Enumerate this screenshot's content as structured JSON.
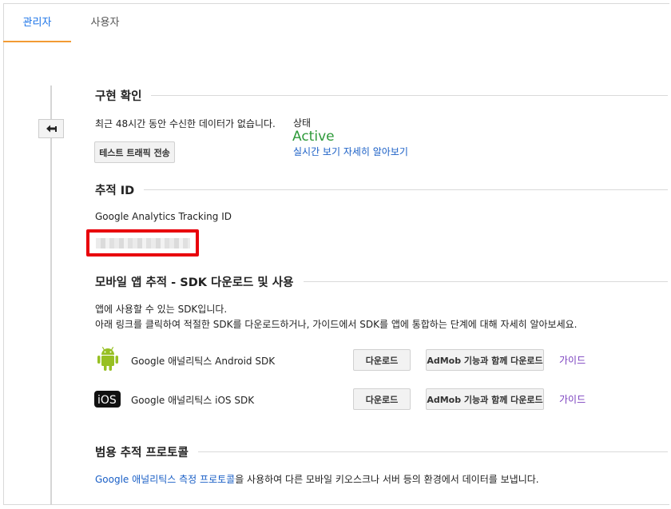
{
  "tabs": {
    "admin": "관리자",
    "user": "사용자"
  },
  "implementation": {
    "title": "구현 확인",
    "no_data_text": "최근 48시간 동안 수신한 데이터가 없습니다.",
    "test_button": "테스트 트래픽 전송",
    "status_label": "상태",
    "status_value": "Active",
    "status_color": "#2e9a3a",
    "realtime_link": "실시간 보기 자세히 알아보기"
  },
  "tracking": {
    "title": "추적 ID",
    "label": "Google Analytics Tracking ID"
  },
  "mobile": {
    "title": "모바일 앱 추적 - SDK 다운로드 및 사용",
    "desc_line1": "앱에 사용할 수 있는 SDK입니다.",
    "desc_line2": "아래 링크를 클릭하여 적절한 SDK를 다운로드하거나, 가이드에서 SDK를 앱에 통합하는 단계에 대해 자세히 알아보세요.",
    "sdks": [
      {
        "icon": "android-icon",
        "name": "Google 애널리틱스 Android SDK",
        "download": "다운로드",
        "admob": "AdMob 기능과 함께 다운로드",
        "guide": "가이드"
      },
      {
        "icon": "ios-icon",
        "name": "Google 애널리틱스 iOS SDK",
        "download": "다운로드",
        "admob": "AdMob 기능과 함께 다운로드",
        "guide": "가이드"
      }
    ]
  },
  "protocol": {
    "title": "범용 추적 프로토콜",
    "link": "Google 애널리틱스 측정 프로토콜",
    "rest": "을 사용하여 다른 모바일 키오스크나 서버 등의 환경에서 데이터를 보냅니다."
  }
}
